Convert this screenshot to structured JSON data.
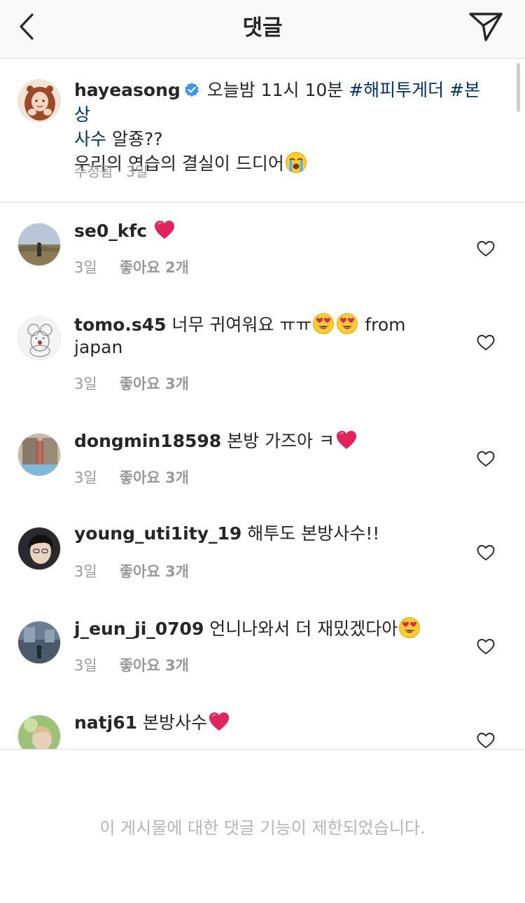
{
  "header": {
    "title": "댓글"
  },
  "caption": {
    "username": "hayeasong",
    "text_before": "오늘밤 11시 10분",
    "hashtag1": "#해피투게더",
    "hashtag2_line1": "#본상",
    "hashtag2_line2": "사수",
    "text_after": "알죵??",
    "line2": "우리의 연습의 결실이 드디어",
    "meta": "수정됨 · 3일"
  },
  "comments": [
    {
      "username": "se0_kfc",
      "text": "",
      "time": "3일",
      "likes": "좋아요 2개"
    },
    {
      "username": "tomo.s45",
      "text": "너무 귀여워요 ㅠㅠ",
      "text_tail": "from",
      "text_line2": "japan",
      "time": "3일",
      "likes": "좋아요 3개"
    },
    {
      "username": "dongmin18598",
      "text": "본방 가즈아 ㅋ",
      "time": "3일",
      "likes": "좋아요 3개"
    },
    {
      "username": "young_uti1ity_19",
      "text": "해투도 본방사수!!",
      "time": "3일",
      "likes": "좋아요 3개"
    },
    {
      "username": "j_eun_ji_0709",
      "text": "언니나와서 더 재밌겠다아",
      "time": "3일",
      "likes": "좋아요 3개"
    },
    {
      "username": "natj61",
      "text": "본방사수",
      "time": "",
      "likes": ""
    }
  ],
  "footer": {
    "restricted_message": "이 게시물에 대한 댓글 기능이 제한되었습니다."
  }
}
